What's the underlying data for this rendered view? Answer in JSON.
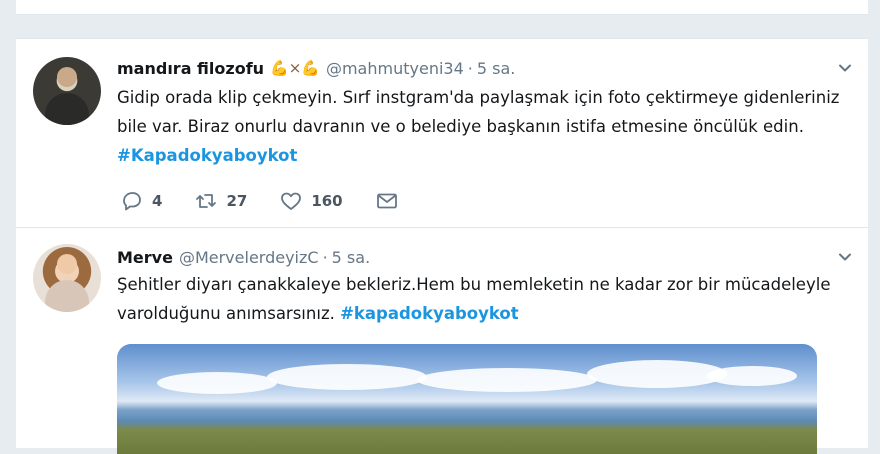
{
  "tweets": [
    {
      "name": "mandıra filozofu",
      "emoji": "💪×💪",
      "handle": "@mahmutyeni34",
      "dot": "·",
      "time": "5 sa.",
      "text": "Gidip orada klip çekmeyin. Sırf instgram'da paylaşmak için foto çektirmeye gidenleriniz bile var. Biraz onurlu davranın ve o belediye başkanın istifa etmesine öncülük edin.",
      "hashtag": "#Kapadokyaboykot",
      "reply_count": "4",
      "retweet_count": "27",
      "like_count": "160"
    },
    {
      "name": "Merve",
      "handle": "@MervelerdeyizC",
      "dot": "·",
      "time": "5 sa.",
      "text": "Şehitler diyarı çanakkaleye bekleriz.Hem bu memleketin ne kadar zor bir mücadeleyle varolduğunu anımsarsınız.",
      "hashtag": "#kapadokyaboykot"
    }
  ],
  "icons": {
    "reply": "reply-icon",
    "retweet": "retweet-icon",
    "like": "heart-icon",
    "dm": "envelope-icon",
    "menu": "chevron-down-icon"
  },
  "colors": {
    "link": "#1b95e0",
    "muted": "#657786",
    "background": "#e6ecf0"
  }
}
